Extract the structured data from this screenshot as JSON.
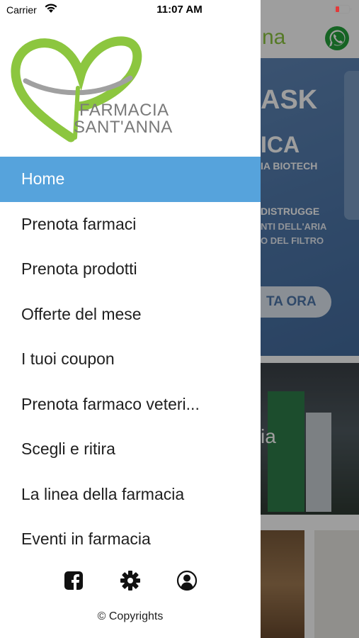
{
  "status_bar": {
    "carrier": "Carrier",
    "time": "11:07 AM"
  },
  "background": {
    "header_text": "na",
    "banner": {
      "line1": "ASK",
      "line2": "ICA",
      "line3": "IA BIOTECH",
      "line4": "DISTRUGGE",
      "line5": "NTI DELL'ARIA",
      "line6": "O DEL FILTRO",
      "cta_label": "TA ORA"
    },
    "photo_text": "ia"
  },
  "drawer": {
    "logo": {
      "line1": "FARMACIA",
      "line2": "SANT'ANNA"
    },
    "menu": [
      {
        "label": "Home",
        "active": true
      },
      {
        "label": "Prenota farmaci",
        "active": false
      },
      {
        "label": "Prenota prodotti",
        "active": false
      },
      {
        "label": "Offerte del mese",
        "active": false
      },
      {
        "label": "I tuoi coupon",
        "active": false
      },
      {
        "label": "Prenota farmaco veteri...",
        "active": false
      },
      {
        "label": "Scegli e ritira",
        "active": false
      },
      {
        "label": "La linea della farmacia",
        "active": false
      },
      {
        "label": "Eventi in farmacia",
        "active": false
      }
    ],
    "social_icons": [
      "facebook-icon",
      "gear-icon",
      "user-profile-icon"
    ],
    "copyright": "© Copyrights"
  },
  "colors": {
    "accent": "#56a3dc",
    "brand_green": "#8cc63f",
    "whatsapp_green": "#25a23a",
    "battery_low": "#e23a3a"
  }
}
